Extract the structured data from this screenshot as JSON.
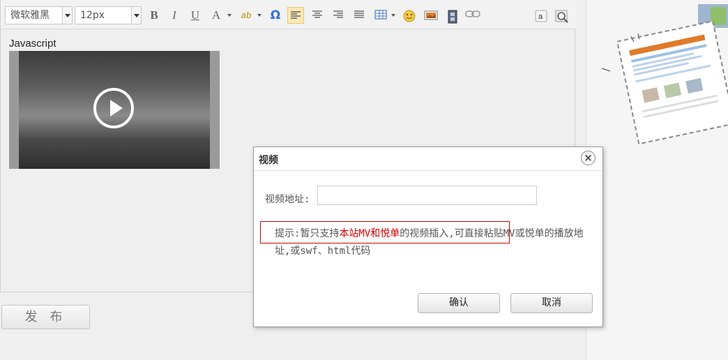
{
  "toolbar": {
    "font_family": "微软雅黑",
    "font_size": "12px",
    "buttons": [
      {
        "name": "bold",
        "glyph": "B"
      },
      {
        "name": "italic",
        "glyph": "I"
      },
      {
        "name": "underline",
        "glyph": "U"
      },
      {
        "name": "font-color",
        "glyph": "A"
      },
      {
        "name": "spellcheck",
        "glyph": "ab"
      },
      {
        "name": "special-char",
        "glyph": "Ω"
      }
    ],
    "accent_color": "#fde9b5"
  },
  "editor": {
    "content_text": "Javascript",
    "video_caption": ""
  },
  "publish_label": "发 布",
  "dialog": {
    "title": "视频",
    "close_glyph": "×",
    "url_label": "视频地址:",
    "url_value": "",
    "hint_prefix": "提示:暂只支持",
    "hint_highlight": "本站MV和悦单",
    "hint_suffix": "的视频插入,可直接粘贴MV或悦单的播放地址,或swf、html代码",
    "confirm_label": "确认",
    "cancel_label": "取消",
    "highlight_color": "#d10000"
  }
}
